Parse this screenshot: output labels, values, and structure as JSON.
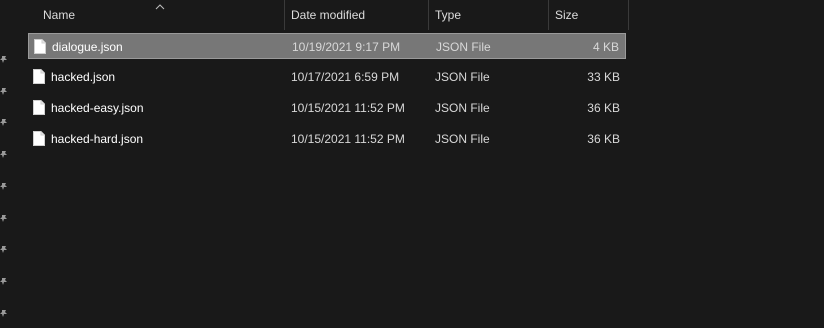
{
  "columns": {
    "name": "Name",
    "date_modified": "Date modified",
    "type": "Type",
    "size": "Size",
    "sort_icon": "sort-ascending-icon"
  },
  "files": [
    {
      "name": "dialogue.json",
      "date": "10/19/2021 9:17 PM",
      "type": "JSON File",
      "size": "4 KB",
      "selected": true
    },
    {
      "name": "hacked.json",
      "date": "10/17/2021 6:59 PM",
      "type": "JSON File",
      "size": "33 KB",
      "selected": false
    },
    {
      "name": "hacked-easy.json",
      "date": "10/15/2021 11:52 PM",
      "type": "JSON File",
      "size": "36 KB",
      "selected": false
    },
    {
      "name": "hacked-hard.json",
      "date": "10/15/2021 11:52 PM",
      "type": "JSON File",
      "size": "36 KB",
      "selected": false
    }
  ],
  "colors": {
    "background": "#191919",
    "selection": "#777777",
    "header_text": "#dcdcdc"
  },
  "left_pane": {
    "pin_icon": "pin-icon",
    "pin_count": 9
  }
}
